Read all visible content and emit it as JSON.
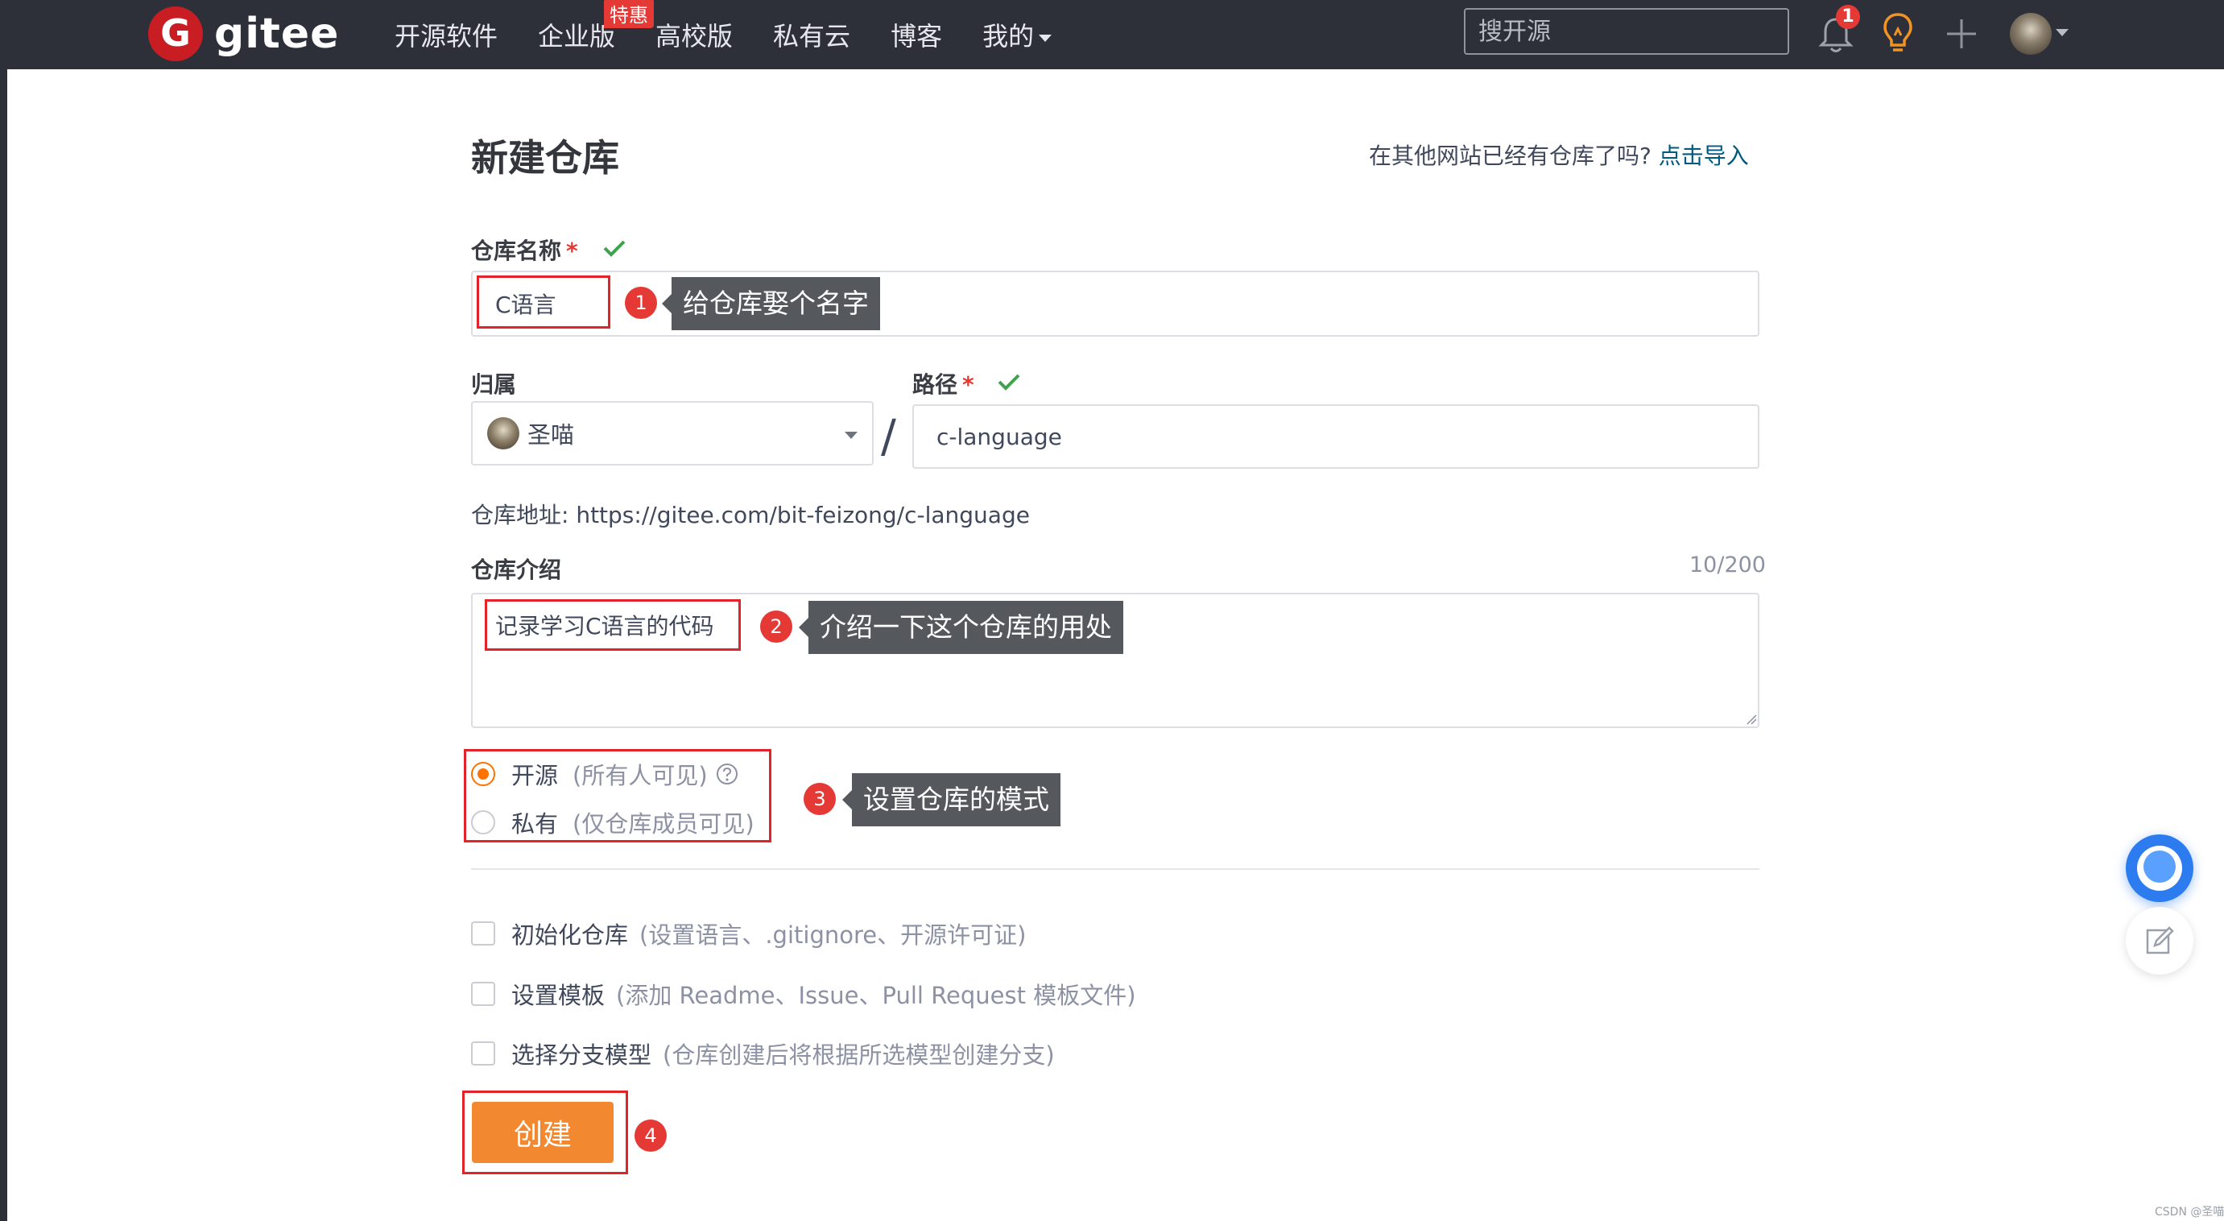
{
  "topnav": {
    "logo_letter": "G",
    "logo_text": "gitee",
    "items": [
      {
        "label": "开源软件"
      },
      {
        "label": "企业版",
        "badge": "特惠"
      },
      {
        "label": "高校版"
      },
      {
        "label": "私有云"
      },
      {
        "label": "博客"
      },
      {
        "label": "我的"
      }
    ],
    "search_placeholder": "搜开源",
    "notification_count": "1",
    "icons": [
      "bell-icon",
      "lightbulb-icon",
      "plus-icon",
      "avatar"
    ]
  },
  "page": {
    "title": "新建仓库",
    "import_prompt": "在其他网站已经有仓库了吗?",
    "import_link": "点击导入"
  },
  "form": {
    "name_label": "仓库名称",
    "name_value": "C语言",
    "owner_label": "归属",
    "owner_value": "圣喵",
    "path_label": "路径",
    "path_value": "c-language",
    "slash": "/",
    "required_mark": "*",
    "repo_url": "仓库地址: https://gitee.com/bit-feizong/c-language",
    "desc_label": "仓库介绍",
    "desc_counter": "10/200",
    "desc_value": "记录学习C语言的代码",
    "visibility": [
      {
        "label": "开源",
        "hint": "(所有人可见)",
        "checked": true
      },
      {
        "label": "私有",
        "hint": "(仅仓库成员可见)",
        "checked": false
      }
    ],
    "options": [
      {
        "label": "初始化仓库",
        "hint": "(设置语言、.gitignore、开源许可证)",
        "checked": false
      },
      {
        "label": "设置模板",
        "hint": "(添加 Readme、Issue、Pull Request 模板文件)",
        "checked": false
      },
      {
        "label": "选择分支模型",
        "hint": "(仓库创建后将根据所选模型创建分支)",
        "checked": false
      }
    ],
    "create_button": "创建"
  },
  "annotations": [
    {
      "number": "1",
      "text": "给仓库娶个名字"
    },
    {
      "number": "2",
      "text": "介绍一下这个仓库的用处"
    },
    {
      "number": "3",
      "text": "设置仓库的模式"
    },
    {
      "number": "4",
      "text": ""
    }
  ],
  "colors": {
    "topbar": "#2d3039",
    "accent": "#fe7300",
    "create_button": "#f2882f",
    "link": "#005980",
    "annotation_red": "#e2242a",
    "tooltip": "#55595d",
    "check_green": "#3fa34d"
  },
  "watermark": "CSDN @圣喵"
}
